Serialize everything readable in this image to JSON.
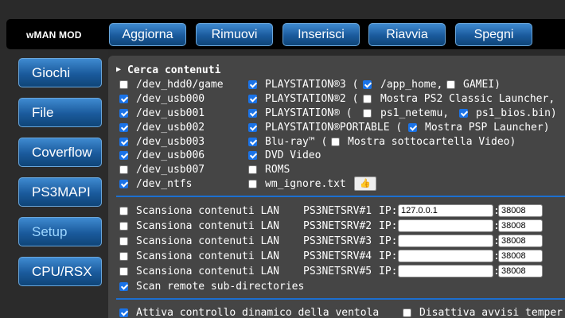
{
  "brand": "wMAN MOD",
  "topnav": [
    "Aggiorna",
    "Rimuovi",
    "Inserisci",
    "Riavvia",
    "Spegni"
  ],
  "sidebar": [
    "Giochi",
    "File",
    "Coverflow",
    "PS3MAPI",
    "Setup",
    "CPU/RSX"
  ],
  "search": {
    "title": "Cerca contenuti",
    "devices": [
      {
        "label": "/dev_hdd0/game",
        "checked": false
      },
      {
        "label": "/dev_usb000",
        "checked": true
      },
      {
        "label": "/dev_usb001",
        "checked": true
      },
      {
        "label": "/dev_usb002",
        "checked": true
      },
      {
        "label": "/dev_usb003",
        "checked": true
      },
      {
        "label": "/dev_usb006",
        "checked": true
      },
      {
        "label": "/dev_usb007",
        "checked": false
      },
      {
        "label": "/dev_ntfs",
        "checked": true
      }
    ],
    "content": [
      {
        "label": "PLAYSTATION®3 (",
        "checked": true
      },
      {
        "label": "PLAYSTATION®2 (",
        "checked": true
      },
      {
        "label": "PLAYSTATION®  (",
        "checked": true
      },
      {
        "label": "PLAYSTATION®PORTABLE (",
        "checked": true
      },
      {
        "label": "Blu-ray™ (",
        "checked": true
      },
      {
        "label": "DVD Video",
        "checked": true
      },
      {
        "label": "ROMS",
        "checked": false
      },
      {
        "label": "wm_ignore.txt",
        "checked": false
      }
    ],
    "extras": {
      "app_home": {
        "label": "/app_home,",
        "checked": true
      },
      "gamei": {
        "label": "GAMEI)",
        "checked": false
      },
      "ps2_launcher": {
        "label": "Mostra PS2 Classic Launcher,",
        "checked": false
      },
      "ps1_netemu": {
        "label": "ps1_netemu,",
        "checked": false
      },
      "ps1_bios": {
        "label": "ps1_bios.bin)",
        "checked": true
      },
      "psp_launcher": {
        "label": "Mostra PSP Launcher)",
        "checked": true
      },
      "video_subfolder": {
        "label": "Mostra sottocartella Video)",
        "checked": false
      }
    },
    "thumb_icon": "thumbs-up-icon"
  },
  "lan": {
    "rows": [
      {
        "label": "Scansiona contenuti LAN",
        "server": "PS3NETSRV#1",
        "ip_label": "IP:",
        "ip": "127.0.0.1",
        "port": "38008",
        "checked": false
      },
      {
        "label": "Scansiona contenuti LAN",
        "server": "PS3NETSRV#2",
        "ip_label": "IP:",
        "ip": "",
        "port": "38008",
        "checked": false
      },
      {
        "label": "Scansiona contenuti LAN",
        "server": "PS3NETSRV#3",
        "ip_label": "IP:",
        "ip": "",
        "port": "38008",
        "checked": false
      },
      {
        "label": "Scansiona contenuti LAN",
        "server": "PS3NETSRV#4",
        "ip_label": "IP:",
        "ip": "",
        "port": "38008",
        "checked": false
      },
      {
        "label": "Scansiona contenuti LAN",
        "server": "PS3NETSRV#5",
        "ip_label": "IP:",
        "ip": "",
        "port": "38008",
        "checked": false
      }
    ],
    "colon": ":",
    "remote_subdirs": {
      "label": "Scan remote sub-directories",
      "checked": true
    }
  },
  "fan": {
    "dynamic": {
      "label": "Attiva controllo dinamico della ventola",
      "checked": true
    },
    "warnings": {
      "label": "Disattiva avvisi temper",
      "checked": false
    }
  },
  "colors": {
    "accent": "#1a73e8",
    "button": "#1a5a9c",
    "divider": "#1c6fd0",
    "panel": "#454545"
  }
}
